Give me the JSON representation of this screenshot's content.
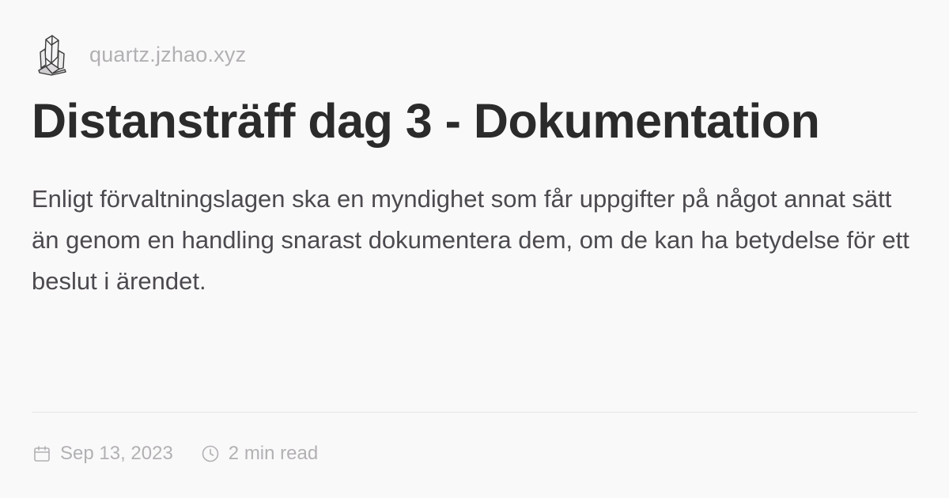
{
  "site": {
    "url": "quartz.jzhao.xyz",
    "logo_icon": "crystal-logo-icon"
  },
  "article": {
    "title": "Distansträff dag 3 - Dokumentation",
    "description": "Enligt förvaltningslagen ska en myndighet som får uppgifter på något annat sätt än genom en handling snarast dokumentera dem, om de kan ha betydelse för ett beslut i ärendet."
  },
  "meta": {
    "date": "Sep 13, 2023",
    "date_icon": "calendar-icon",
    "read_time": "2 min read",
    "read_time_icon": "clock-icon"
  },
  "colors": {
    "background": "#faf9fa",
    "title": "#2b2b2b",
    "body_text": "#4d4a4f",
    "muted_text": "#b3b0b4",
    "divider": "#e6e4e7"
  }
}
